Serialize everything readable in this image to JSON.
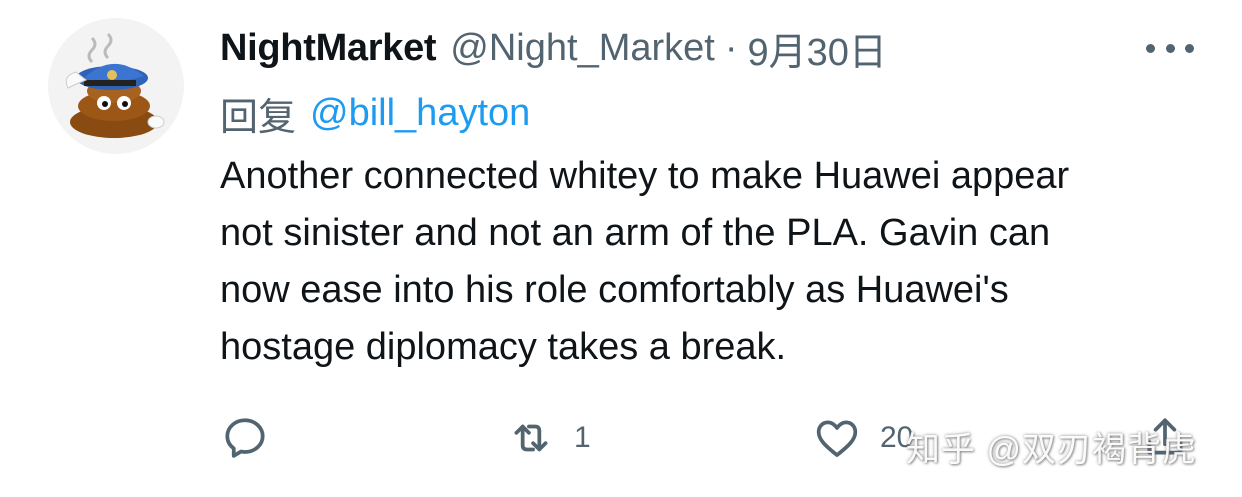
{
  "tweet": {
    "display_name": "NightMarket",
    "handle": "@Night_Market",
    "separator": "·",
    "date": "9月30日",
    "reply_prefix": "回复",
    "reply_to": "@bill_hayton",
    "text_lines": [
      "Another connected whitey to make Huawei appear",
      "not sinister and not an arm of the PLA. Gavin can",
      "now ease into his role comfortably as Huawei's",
      "hostage diplomacy takes a break."
    ]
  },
  "actions": {
    "reply_icon": "comment-icon",
    "retweet_icon": "retweet-icon",
    "retweet_count": "1",
    "like_icon": "heart-icon",
    "like_count": "20",
    "share_icon": "share-icon"
  },
  "watermark": "知乎 @双刃褐背虎",
  "colors": {
    "primary_text": "#0f1419",
    "secondary_text": "#536471",
    "link": "#1d9bf0",
    "background": "#ffffff"
  }
}
